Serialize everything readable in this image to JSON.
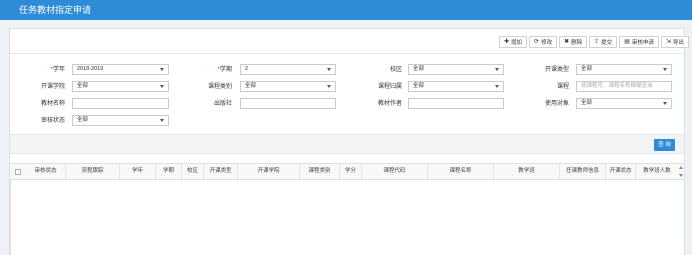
{
  "app": {
    "title": "任务教材指定申请"
  },
  "toolbar": {
    "add": "增加",
    "edit": "修改",
    "delete": "删除",
    "submit": "提交",
    "approve": "审核申请",
    "export": "导出"
  },
  "form": {
    "academic_year": {
      "label": "学年",
      "value": "2018-2019"
    },
    "term": {
      "label": "学期",
      "value": "2"
    },
    "campus": {
      "label": "校区",
      "value": "全部"
    },
    "course_type": {
      "label": "开课类型",
      "value": "全部"
    },
    "college": {
      "label": "开课学院",
      "value": "全部"
    },
    "course_category": {
      "label": "课程类别",
      "value": "全部"
    },
    "course_belong": {
      "label": "课程归属",
      "value": "全部"
    },
    "course": {
      "label": "课程",
      "placeholder": "按课程号、课程名称模糊查询"
    },
    "textbook_name": {
      "label": "教材名称",
      "value": ""
    },
    "publisher": {
      "label": "出版社",
      "value": ""
    },
    "author": {
      "label": "教材作者",
      "value": ""
    },
    "target": {
      "label": "使用对象",
      "value": "全部"
    },
    "review_status": {
      "label": "审核状态",
      "value": "全部"
    }
  },
  "query_button": "查 询",
  "table": {
    "columns": [
      "审核状态",
      "流程跟踪",
      "学年",
      "学期",
      "校区",
      "开课类型",
      "开课学院",
      "课程类别",
      "学分",
      "课程代码",
      "课程名称",
      "教学班",
      "任课教师信息",
      "开课状态",
      "教学班人数"
    ]
  }
}
